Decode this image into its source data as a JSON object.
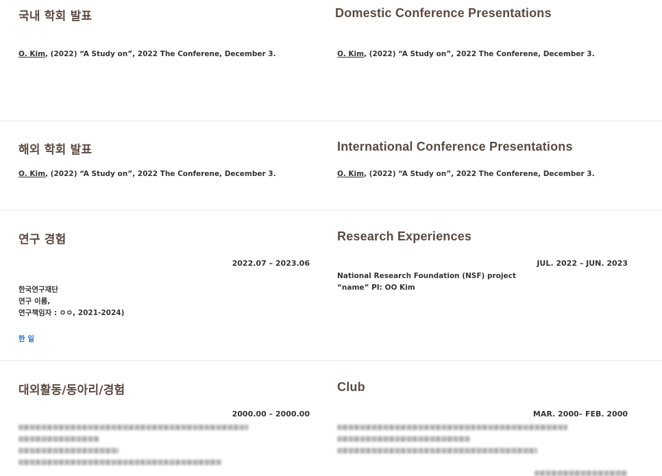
{
  "domestic": {
    "heading_ko": "국내 학회 발표",
    "heading_en": "Domestic Conference Presentations",
    "citation_author": "O. Kim",
    "citation_rest": ",  (2022) “A Study on”, 2022 The Conferene, December 3."
  },
  "international": {
    "heading_ko": "해외 학회 발표",
    "heading_en": "International Conference Presentations",
    "citation_author": "O. Kim",
    "citation_rest": ",  (2022) “A Study on”, 2022 The Conferene, December 3."
  },
  "research": {
    "heading_ko": "연구 경험",
    "heading_en": "Research Experiences",
    "date_ko": "2022.07 – 2023.06",
    "date_en": "JUL. 2022 – JUN. 2023",
    "lines_ko": [
      "한국연구재단",
      "연구 이름,",
      "연구책임자 : ㅇㅇ, 2021-2024)"
    ],
    "lines_en": [
      "National Research Foundation (NSF) project",
      "“name” PI: OO Kim"
    ],
    "link_ko": "한 일"
  },
  "club": {
    "heading_ko": "대외활동/동아리/경험",
    "heading_en": "Club",
    "date_ko": "2000.00 – 2000.00",
    "date_en": "MAR. 2000– FEB. 2000"
  }
}
